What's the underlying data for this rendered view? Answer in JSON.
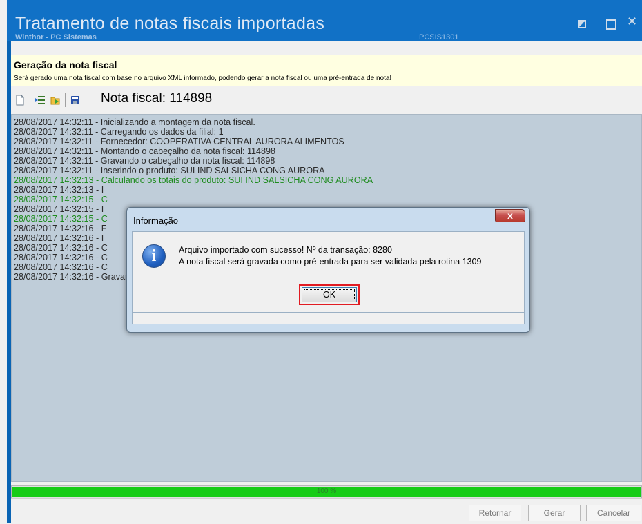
{
  "window": {
    "title": "Tratamento de notas fiscais importadas",
    "subtitle": "Winthor - PC Sistemas",
    "routine_code": "PCSIS1301"
  },
  "header": {
    "title": "Geração da nota fiscal",
    "description": "Será gerado uma nota fiscal com base no arquivo XML informado, podendo gerar a nota fiscal ou uma pré-entrada de nota!"
  },
  "toolbar": {
    "icons": [
      "new-document-icon",
      "import-icon",
      "export-icon",
      "save-icon"
    ],
    "nota_label": "Nota fiscal: 114898"
  },
  "log": {
    "lines": [
      {
        "text": "28/08/2017 14:32:11 - Inicializando a montagem da nota fiscal.",
        "color": "#2b2b2b"
      },
      {
        "text": "28/08/2017 14:32:11 - Carregando os dados da filial: 1",
        "color": "#2b2b2b"
      },
      {
        "text": "28/08/2017 14:32:11 - Fornecedor: COOPERATIVA CENTRAL AURORA ALIMENTOS",
        "color": "#2b2b2b"
      },
      {
        "text": "28/08/2017 14:32:11 - Montando o cabeçalho da nota fiscal: 114898",
        "color": "#2b2b2b"
      },
      {
        "text": "28/08/2017 14:32:11 - Gravando o cabeçalho da nota fiscal: 114898",
        "color": "#2b2b2b"
      },
      {
        "text": "28/08/2017 14:32:11 - Inserindo o produto: SUI IND SALSICHA CONG AURORA",
        "color": "#2b2b2b"
      },
      {
        "text": "28/08/2017 14:32:13 - Calculando os totais do produto: SUI IND SALSICHA CONG AURORA",
        "color": "#1e8b1e"
      },
      {
        "text": "28/08/2017 14:32:13 - I",
        "color": "#2b2b2b"
      },
      {
        "text": "28/08/2017 14:32:15 - C",
        "color": "#1e8b1e"
      },
      {
        "text": "28/08/2017 14:32:15 - I",
        "color": "#2b2b2b"
      },
      {
        "text": "28/08/2017 14:32:15 - C",
        "color": "#1e8b1e"
      },
      {
        "text": "28/08/2017 14:32:16 - F",
        "color": "#2b2b2b"
      },
      {
        "text": "28/08/2017 14:32:16 - I",
        "color": "#2b2b2b"
      },
      {
        "text": "28/08/2017 14:32:16 - C",
        "color": "#2b2b2b"
      },
      {
        "text": "28/08/2017 14:32:16 - C",
        "color": "#2b2b2b"
      },
      {
        "text": "28/08/2017 14:32:16 - C",
        "color": "#2b2b2b"
      },
      {
        "text": "28/08/2017 14:32:16 - Gravando o pedido.",
        "color": "#2b2b2b"
      }
    ]
  },
  "progress": {
    "percent": 100,
    "label": "100 %",
    "color": "#17cc17"
  },
  "footer": {
    "retornar_label": "Retornar",
    "gerar_label": "Gerar",
    "cancelar_label": "Cancelar"
  },
  "dialog": {
    "title": "Informação",
    "close_label": "x",
    "message_line1": "Arquivo importado com sucesso! Nº da transação: 8280",
    "message_line2": "A nota fiscal será gravada como pré-entrada para ser validada pela rotina 1309",
    "ok_label": "OK",
    "highlight_color": "#e11b22"
  }
}
